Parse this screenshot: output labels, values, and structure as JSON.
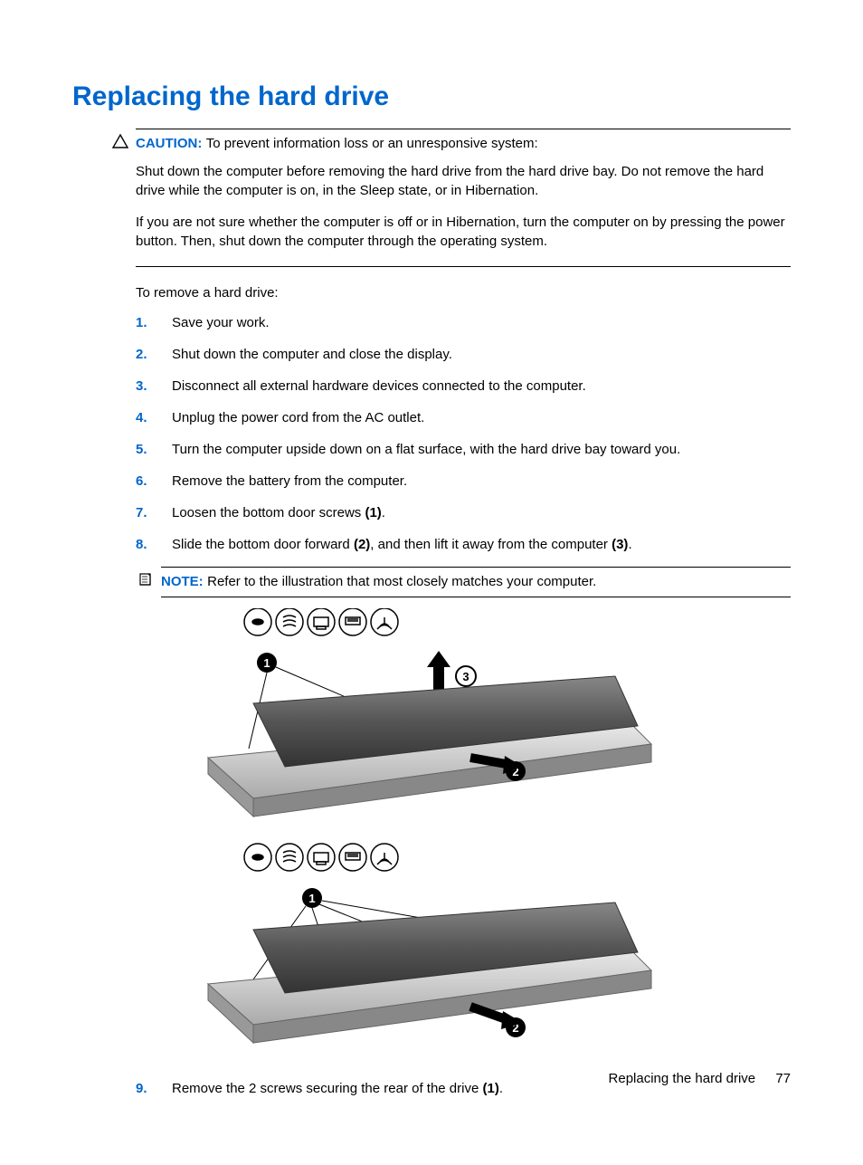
{
  "heading": "Replacing the hard drive",
  "caution": {
    "label": "CAUTION:",
    "lead": "To prevent information loss or an unresponsive system:",
    "para1": "Shut down the computer before removing the hard drive from the hard drive bay. Do not remove the hard drive while the computer is on, in the Sleep state, or in Hibernation.",
    "para2": "If you are not sure whether the computer is off or in Hibernation, turn the computer on by pressing the power button. Then, shut down the computer through the operating system."
  },
  "intro": "To remove a hard drive:",
  "steps": {
    "s1": {
      "n": "1.",
      "t": "Save your work."
    },
    "s2": {
      "n": "2.",
      "t": "Shut down the computer and close the display."
    },
    "s3": {
      "n": "3.",
      "t": "Disconnect all external hardware devices connected to the computer."
    },
    "s4": {
      "n": "4.",
      "t": "Unplug the power cord from the AC outlet."
    },
    "s5": {
      "n": "5.",
      "t": "Turn the computer upside down on a flat surface, with the hard drive bay toward you."
    },
    "s6": {
      "n": "6.",
      "t": "Remove the battery from the computer."
    },
    "s7": {
      "n": "7.",
      "a": "Loosen the bottom door screws ",
      "b": "(1)",
      "c": "."
    },
    "s8": {
      "n": "8.",
      "a": "Slide the bottom door forward ",
      "b": "(2)",
      "c": ", and then lift it away from the computer ",
      "d": "(3)",
      "e": "."
    },
    "s9": {
      "n": "9.",
      "a": "Remove the 2 screws securing the rear of the drive ",
      "b": "(1)",
      "c": "."
    }
  },
  "note": {
    "label": "NOTE:",
    "text": "Refer to the illustration that most closely matches your computer."
  },
  "footer": {
    "section": "Replacing the hard drive",
    "page": "77"
  }
}
